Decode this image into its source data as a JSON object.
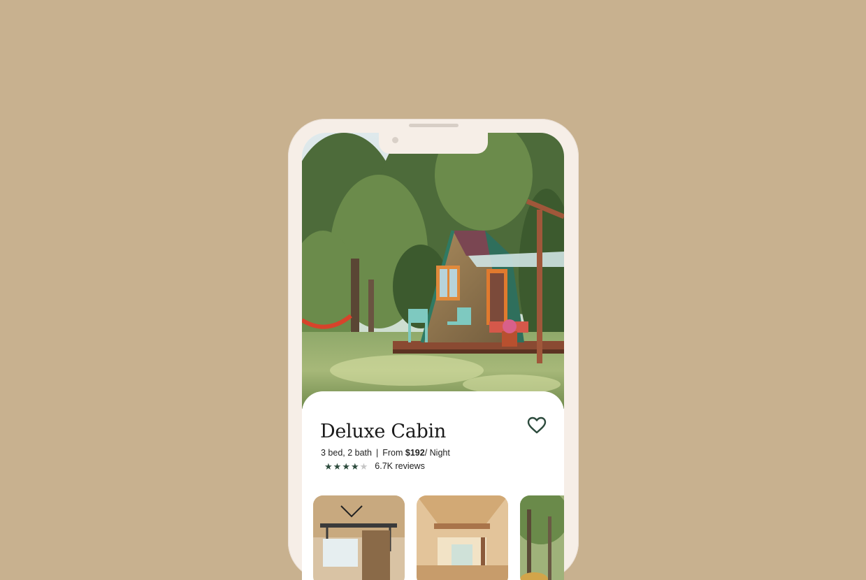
{
  "listing": {
    "title": "Deluxe Cabin",
    "beds_baths": "3 bed, 2 bath",
    "separator": "|",
    "price_prefix": "From",
    "price": "$192",
    "price_unit": "/ Night",
    "rating": {
      "stars_filled": 4,
      "stars_total": 5
    },
    "reviews": "6.7K reviews"
  },
  "icons": {
    "favorite": "heart-outline-icon",
    "rating_star": "star-icon"
  },
  "gallery": [
    {
      "name": "loft-interior-photo"
    },
    {
      "name": "wood-interior-photo"
    },
    {
      "name": "forest-exterior-photo"
    }
  ],
  "colors": {
    "background": "#c8b18f",
    "phone_frame": "#f6eee7",
    "accent_green": "#2c4a3c"
  }
}
